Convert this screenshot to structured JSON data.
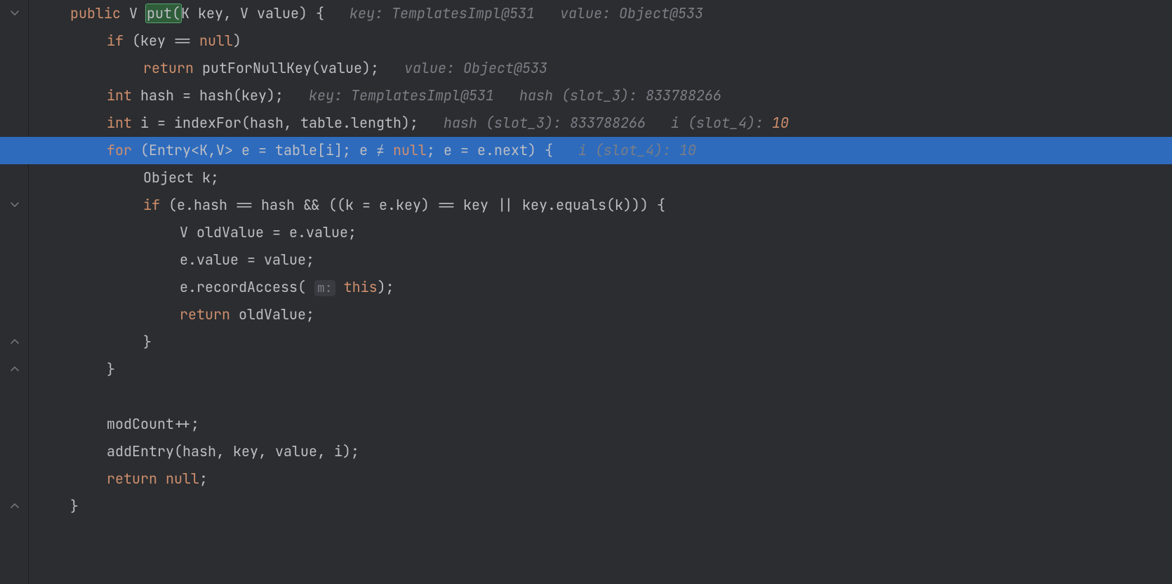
{
  "colors": {
    "background": "#2b2d30",
    "keyword": "#cf8e6d",
    "text": "#bcbec4",
    "hint": "#7a7e85",
    "highlight_bg": "#2e6bbd",
    "selection_bg": "#2f5d3a"
  },
  "highlighted_line_index": 5,
  "selected_text": "put(",
  "lines": [
    {
      "indent": 1,
      "tokens": [
        {
          "t": "public ",
          "c": "kw"
        },
        {
          "t": "V ",
          "c": "text"
        },
        {
          "t": "put(",
          "c": "text",
          "selected": true
        },
        {
          "t": "K key, V value) {   ",
          "c": "text"
        },
        {
          "t": "key: TemplatesImpl@531   value: Object@533",
          "c": "hint"
        }
      ],
      "fold": "end"
    },
    {
      "indent": 2,
      "tokens": [
        {
          "t": "if ",
          "c": "kw"
        },
        {
          "t": "(key ",
          "c": "text"
        },
        {
          "t": "== ",
          "c": "op"
        },
        {
          "t": "null",
          "c": "kw"
        },
        {
          "t": ")",
          "c": "text"
        }
      ]
    },
    {
      "indent": 3,
      "tokens": [
        {
          "t": "return ",
          "c": "kw"
        },
        {
          "t": "putForNullKey(value);   ",
          "c": "text"
        },
        {
          "t": "value: Object@533",
          "c": "hint"
        }
      ]
    },
    {
      "indent": 2,
      "tokens": [
        {
          "t": "int ",
          "c": "kw"
        },
        {
          "t": "hash = hash(key);   ",
          "c": "text"
        },
        {
          "t": "key: TemplatesImpl@531   hash (slot_3): 833788266",
          "c": "hint"
        }
      ]
    },
    {
      "indent": 2,
      "tokens": [
        {
          "t": "int ",
          "c": "kw"
        },
        {
          "t": "i = indexFor(hash, table.length);   ",
          "c": "text"
        },
        {
          "t": "hash (slot_3): 833788266   i (slot_4): ",
          "c": "hint"
        },
        {
          "t": "10",
          "c": "val"
        }
      ]
    },
    {
      "indent": 2,
      "highlight": true,
      "tokens": [
        {
          "t": "for ",
          "c": "kw"
        },
        {
          "t": "(Entry<K,V> e = table[i]; e ",
          "c": "text"
        },
        {
          "t": "≠ ",
          "c": "op"
        },
        {
          "t": "null",
          "c": "kw"
        },
        {
          "t": "; e = e.next) {   ",
          "c": "text"
        },
        {
          "t": "i (slot_4): 10",
          "c": "hint"
        }
      ],
      "fold": "end"
    },
    {
      "indent": 3,
      "tokens": [
        {
          "t": "Object k;",
          "c": "text"
        }
      ]
    },
    {
      "indent": 3,
      "tokens": [
        {
          "t": "if ",
          "c": "kw"
        },
        {
          "t": "(e.hash ",
          "c": "text"
        },
        {
          "t": "== ",
          "c": "op"
        },
        {
          "t": "hash && ((k = e.key) ",
          "c": "text"
        },
        {
          "t": "== ",
          "c": "op"
        },
        {
          "t": "key || key.equals(k))) {",
          "c": "text"
        }
      ],
      "fold": "end"
    },
    {
      "indent": 4,
      "tokens": [
        {
          "t": "V oldValue = e.value;",
          "c": "text"
        }
      ]
    },
    {
      "indent": 4,
      "tokens": [
        {
          "t": "e.value = value;",
          "c": "text"
        }
      ]
    },
    {
      "indent": 4,
      "tokens": [
        {
          "t": "e.recordAccess( ",
          "c": "text"
        },
        {
          "t": "m:",
          "c": "mhint"
        },
        {
          "t": " ",
          "c": "text"
        },
        {
          "t": "this",
          "c": "kw"
        },
        {
          "t": ");",
          "c": "text"
        }
      ]
    },
    {
      "indent": 4,
      "tokens": [
        {
          "t": "return ",
          "c": "kw"
        },
        {
          "t": "oldValue;",
          "c": "text"
        }
      ]
    },
    {
      "indent": 3,
      "tokens": [
        {
          "t": "}",
          "c": "text"
        }
      ],
      "fold": "start"
    },
    {
      "indent": 2,
      "tokens": [
        {
          "t": "}",
          "c": "text"
        }
      ],
      "fold": "start"
    },
    {
      "indent": 2,
      "tokens": [
        {
          "t": "",
          "c": "text"
        }
      ]
    },
    {
      "indent": 2,
      "tokens": [
        {
          "t": "modCount++;",
          "c": "text"
        }
      ]
    },
    {
      "indent": 2,
      "tokens": [
        {
          "t": "addEntry(hash, key, value, i);",
          "c": "text"
        }
      ]
    },
    {
      "indent": 2,
      "tokens": [
        {
          "t": "return ",
          "c": "kw"
        },
        {
          "t": "null",
          "c": "kw"
        },
        {
          "t": ";",
          "c": "text"
        }
      ]
    },
    {
      "indent": 1,
      "tokens": [
        {
          "t": "}",
          "c": "text"
        }
      ],
      "fold": "start"
    }
  ]
}
